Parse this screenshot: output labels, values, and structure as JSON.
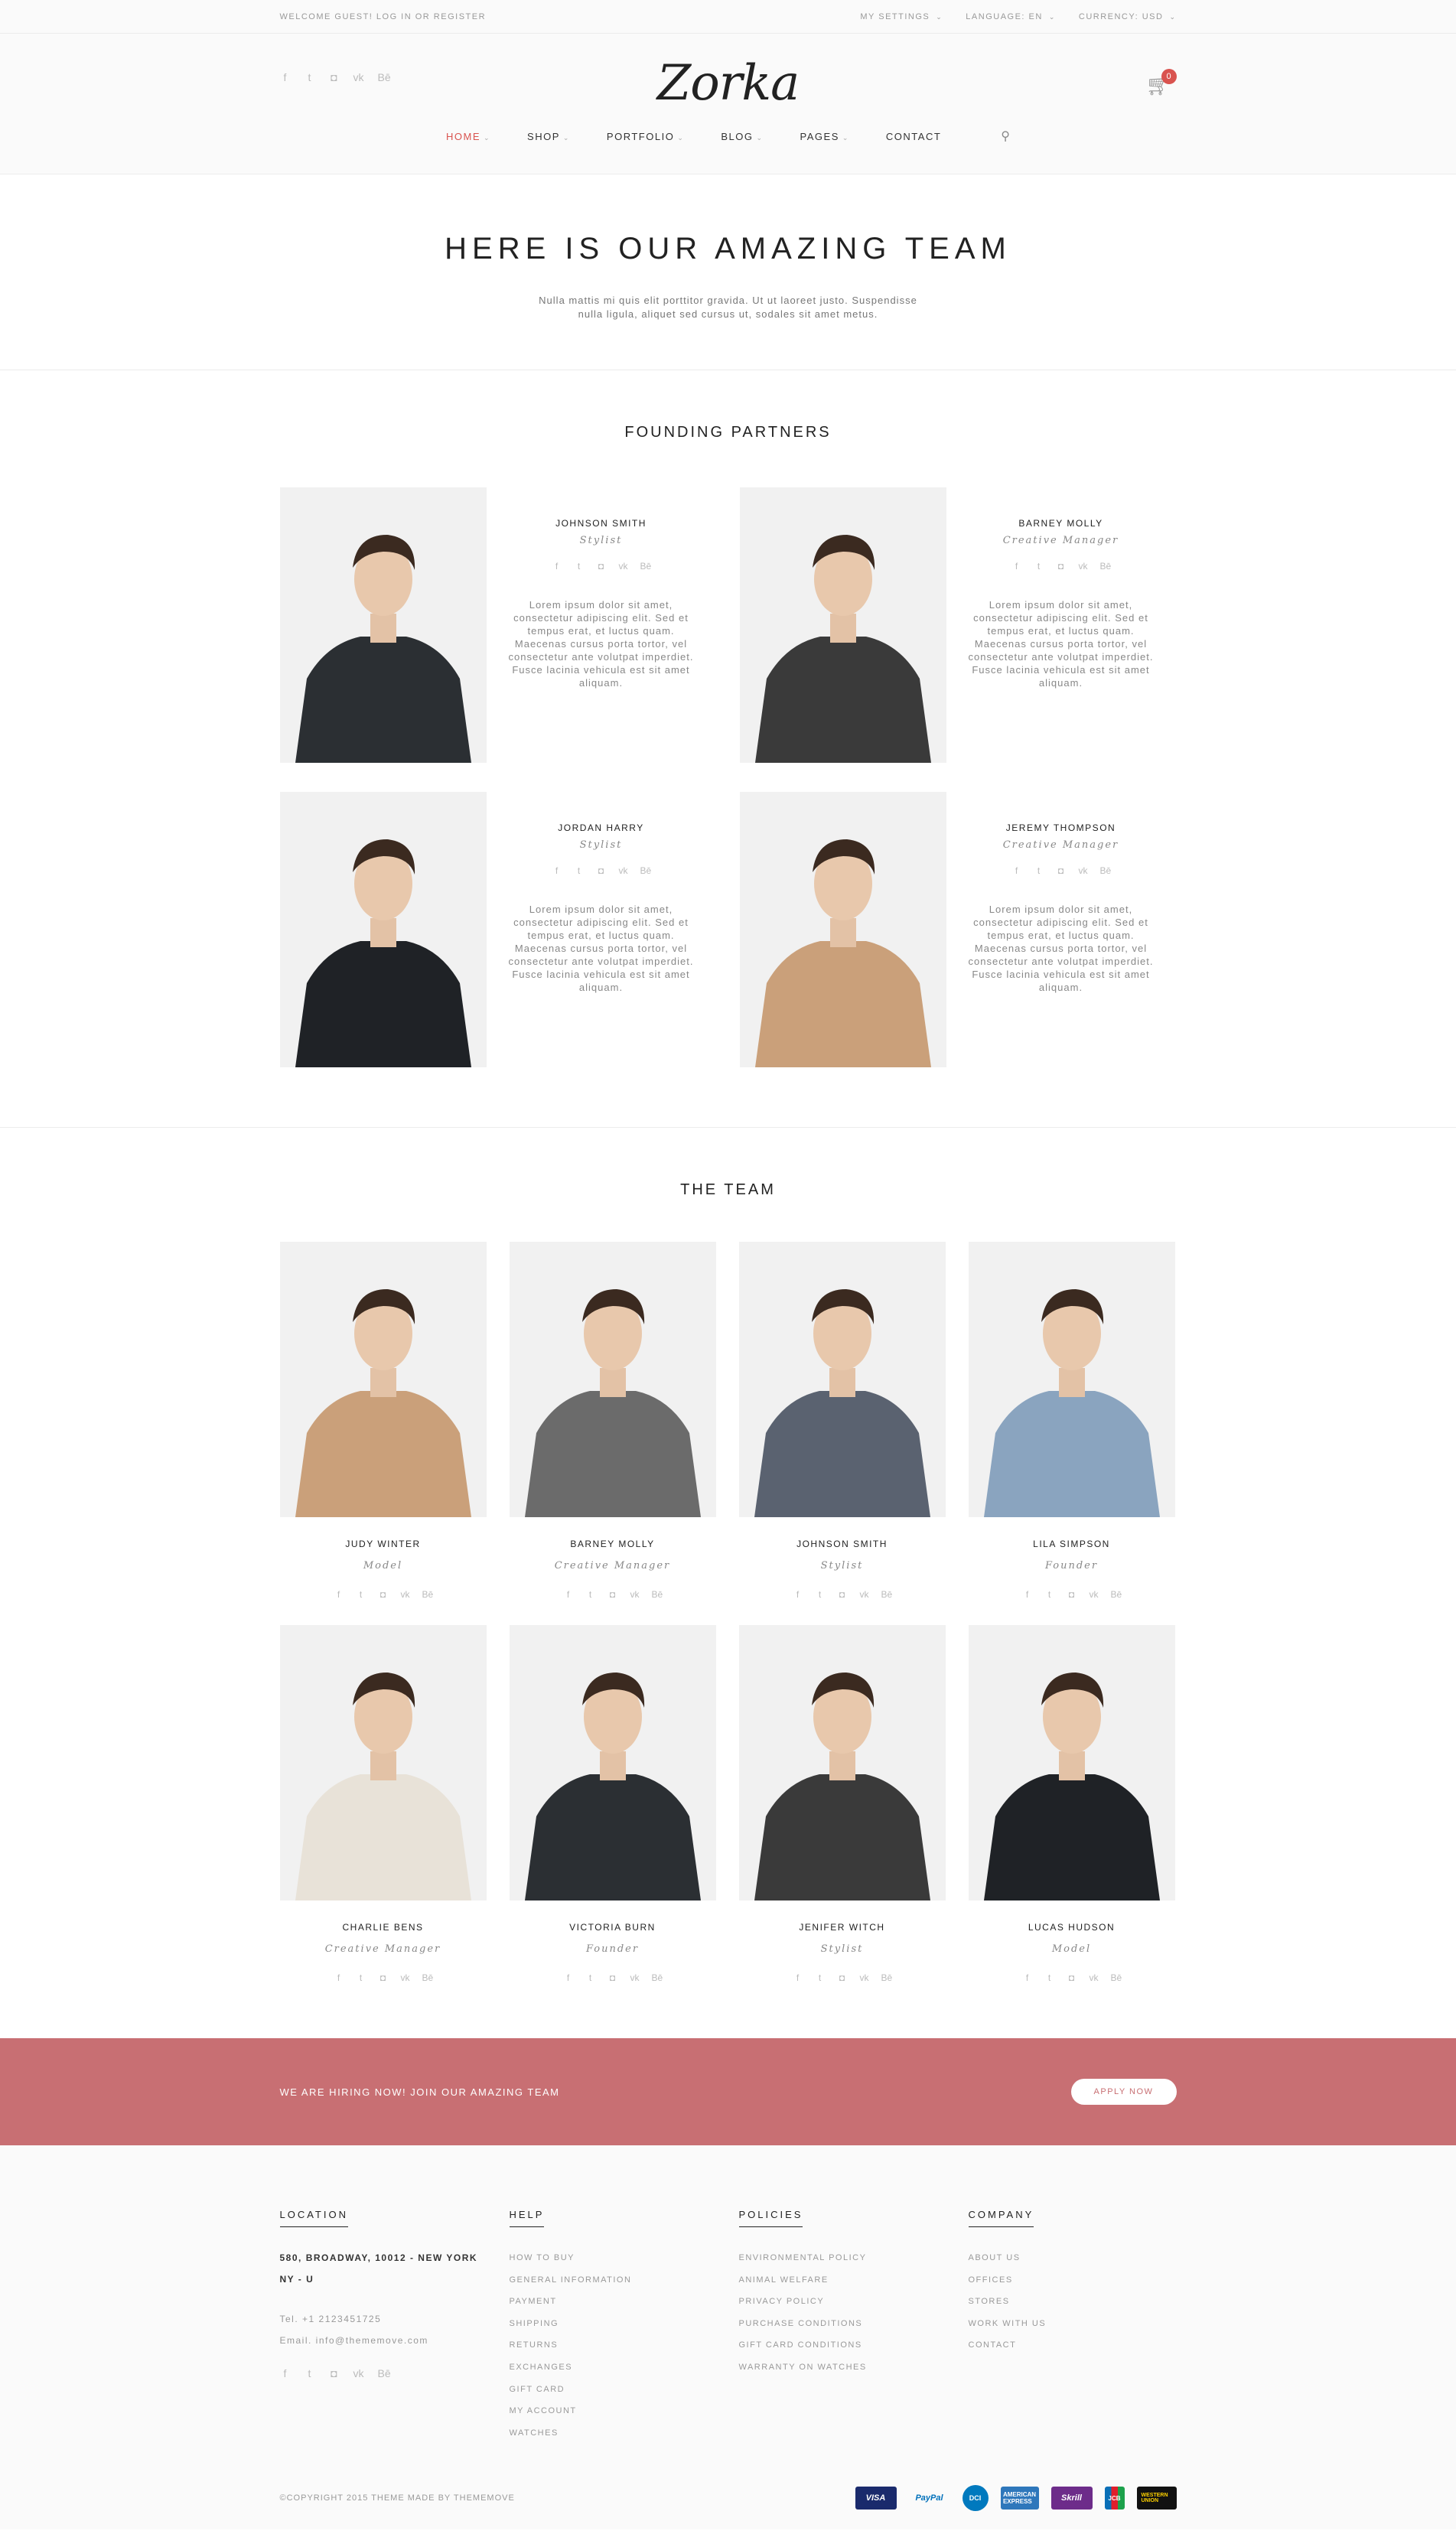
{
  "topbar": {
    "welcome": "WELCOME GUEST! LOG IN OR REGISTER",
    "settings": "MY SETTINGS",
    "language": "LANGUAGE: EN",
    "currency": "CURRENCY: USD"
  },
  "header": {
    "logo": "Zorka",
    "cart_count": "0",
    "social_icons": [
      "facebook-icon",
      "twitter-icon",
      "instagram-icon",
      "vk-icon",
      "behance-icon"
    ]
  },
  "nav": {
    "items": [
      {
        "label": "HOME",
        "active": true,
        "dropdown": true
      },
      {
        "label": "SHOP",
        "dropdown": true
      },
      {
        "label": "PORTFOLIO",
        "dropdown": true
      },
      {
        "label": "BLOG",
        "dropdown": true
      },
      {
        "label": "PAGES",
        "dropdown": true
      },
      {
        "label": "CONTACT",
        "dropdown": false
      }
    ]
  },
  "hero": {
    "title": "HERE IS OUR AMAZING TEAM",
    "text": "Nulla mattis mi quis elit porttitor gravida. Ut ut laoreet justo. Suspendisse nulla ligula, aliquet sed cursus ut, sodales sit amet metus."
  },
  "partners": {
    "title": "FOUNDING PARTNERS",
    "bio": "Lorem ipsum dolor sit amet, consectetur adipiscing elit. Sed et tempus erat, et luctus quam. Maecenas cursus porta tortor, vel consectetur ante volutpat imperdiet. Fusce lacinia vehicula est sit amet aliquam.",
    "items": [
      {
        "name": "JOHNSON SMITH",
        "role": "Stylist"
      },
      {
        "name": "BARNEY MOLLY",
        "role": "Creative Manager"
      },
      {
        "name": "JORDAN HARRY",
        "role": "Stylist"
      },
      {
        "name": "JEREMY THOMPSON",
        "role": "Creative Manager"
      }
    ]
  },
  "team": {
    "title": "THE TEAM",
    "members": [
      {
        "name": "JUDY WINTER",
        "role": "Model"
      },
      {
        "name": "BARNEY MOLLY",
        "role": "Creative Manager"
      },
      {
        "name": "JOHNSON SMITH",
        "role": "Stylist"
      },
      {
        "name": "LILA SIMPSON",
        "role": "Founder"
      },
      {
        "name": "CHARLIE BENS",
        "role": "Creative Manager"
      },
      {
        "name": "VICTORIA BURN",
        "role": "Founder"
      },
      {
        "name": "JENIFER WITCH",
        "role": "Stylist"
      },
      {
        "name": "LUCAS HUDSON",
        "role": "Model"
      }
    ]
  },
  "hiring": {
    "text": "WE ARE HIRING NOW! JOIN OUR AMAZING TEAM",
    "button": "APPLY NOW"
  },
  "footer": {
    "location": {
      "title": "LOCATION",
      "address_line1": "580, BROADWAY, 10012 - NEW YORK",
      "address_line2": "NY - U",
      "phone": "Tel. +1 2123451725",
      "email": "Email. info@thememove.com"
    },
    "help": {
      "title": "HELP",
      "links": [
        "HOW TO BUY",
        "GENERAL INFORMATION",
        "PAYMENT",
        "SHIPPING",
        "RETURNS",
        "EXCHANGES",
        "GIFT CARD",
        "MY ACCOUNT",
        "WATCHES"
      ]
    },
    "policies": {
      "title": "POLICIES",
      "links": [
        "ENVIRONMENTAL POLICY",
        "ANIMAL WELFARE",
        "PRIVACY POLICY",
        "PURCHASE CONDITIONS",
        "GIFT CARD CONDITIONS",
        "WARRANTY ON WATCHES"
      ]
    },
    "company": {
      "title": "COMPANY",
      "links": [
        "ABOUT US",
        "OFFICES",
        "STORES",
        "WORK WITH US",
        "CONTACT"
      ]
    },
    "copyright": "©COPYRIGHT 2015 THEME MADE BY THEMEMOVE",
    "payments": [
      "VISA",
      "PayPal",
      "DCI",
      "AMERICAN EXPRESS",
      "Skrill",
      "JCB",
      "WESTERN UNION"
    ]
  }
}
